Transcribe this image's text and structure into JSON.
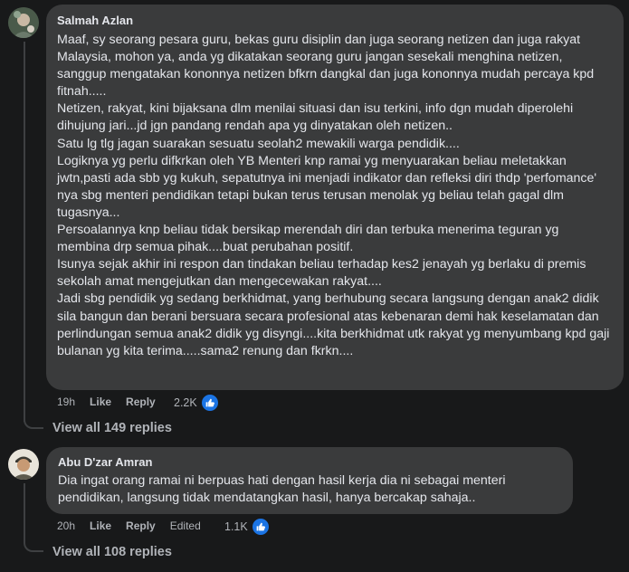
{
  "comments": [
    {
      "author": "Salmah Azlan",
      "paragraphs": [
        "Maaf, sy seorang pesara guru, bekas guru disiplin dan juga seorang netizen dan juga rakyat Malaysia, mohon ya, anda yg dikatakan seorang guru jangan sesekali menghina netizen, sanggup mengatakan kononnya netizen bfkrn dangkal dan juga kononnya mudah percaya kpd fitnah.....",
        "Netizen, rakyat, kini bijaksana dlm menilai situasi dan isu terkini, info dgn mudah diperolehi dihujung jari...jd jgn pandang rendah apa yg dinyatakan oleh netizen..",
        "Satu lg tlg jagan suarakan sesuatu seolah2 mewakili warga pendidik....",
        "Logiknya yg perlu difkrkan oleh YB Menteri knp ramai yg menyuarakan beliau meletakkan jwtn,pasti ada sbb yg kukuh, sepatutnya ini menjadi indikator dan refleksi diri thdp 'perfomance' nya sbg menteri pendidikan tetapi bukan terus terusan menolak yg beliau telah gagal dlm tugasnya...",
        "Persoalannya knp beliau tidak bersikap merendah diri dan terbuka menerima teguran yg membina drp semua pihak....buat perubahan positif.",
        "Isunya sejak akhir ini respon dan tindakan beliau terhadap kes2 jenayah yg berlaku di premis sekolah amat mengejutkan dan mengecewakan rakyat....",
        "Jadi sbg pendidik yg sedang berkhidmat, yang berhubung secara langsung dengan anak2 didik sila bangun dan berani bersuara secara profesional atas kebenaran demi hak keselamatan dan perlindungan semua anak2 didik yg disyngi....kita berkhidmat utk rakyat yg menyumbang kpd gaji bulanan yg kita terima.....sama2 renung dan fkrkn...."
      ],
      "time": "19h",
      "like_label": "Like",
      "reply_label": "Reply",
      "edited_label": "",
      "reaction_count": "2.2K",
      "reaction_icon": "like-icon",
      "view_replies": "View all 149 replies"
    },
    {
      "author": "Abu D'zar Amran",
      "paragraphs": [
        "Dia ingat orang ramai ni berpuas hati dengan hasil kerja dia ni sebagai menteri pendidikan, langsung tidak mendatangkan hasil, hanya bercakap sahaja.."
      ],
      "time": "20h",
      "like_label": "Like",
      "reply_label": "Reply",
      "edited_label": "Edited",
      "reaction_count": "1.1K",
      "reaction_icon": "like-icon",
      "view_replies": "View all 108 replies"
    }
  ],
  "colors": {
    "background": "#18191a",
    "bubble": "#3a3b3c",
    "text": "#e4e6eb",
    "muted": "#b0b3b8",
    "like_blue": "#1b74e4"
  }
}
